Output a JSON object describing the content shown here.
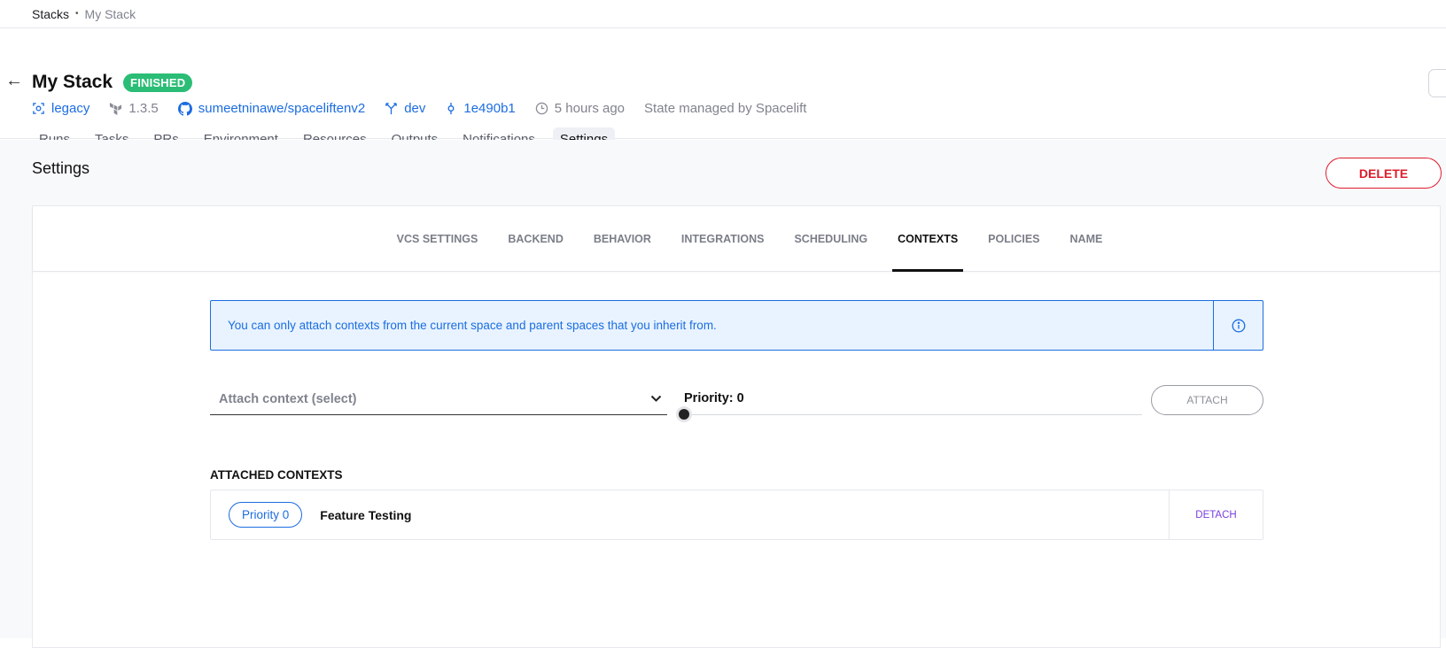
{
  "breadcrumb": {
    "root": "Stacks",
    "separator": "•",
    "current": "My Stack"
  },
  "stack": {
    "title": "My Stack",
    "status": "FINISHED",
    "status_color": "#2bbd76",
    "meta": {
      "space": "legacy",
      "version": "1.3.5",
      "repo": "sumeetninawe/spaceliftenv2",
      "branch": "dev",
      "commit": "1e490b1",
      "time": "5 hours ago",
      "state": "State managed by Spacelift"
    }
  },
  "tabs": [
    {
      "label": "Runs",
      "active": false
    },
    {
      "label": "Tasks",
      "active": false
    },
    {
      "label": "PRs",
      "active": false
    },
    {
      "label": "Environment",
      "active": false
    },
    {
      "label": "Resources",
      "active": false
    },
    {
      "label": "Outputs",
      "active": false
    },
    {
      "label": "Notifications",
      "active": false
    },
    {
      "label": "Settings",
      "active": true
    }
  ],
  "settings": {
    "title": "Settings",
    "delete_label": "DELETE",
    "subtabs": [
      {
        "label": "VCS SETTINGS",
        "active": false
      },
      {
        "label": "BACKEND",
        "active": false
      },
      {
        "label": "BEHAVIOR",
        "active": false
      },
      {
        "label": "INTEGRATIONS",
        "active": false
      },
      {
        "label": "SCHEDULING",
        "active": false
      },
      {
        "label": "CONTEXTS",
        "active": true
      },
      {
        "label": "POLICIES",
        "active": false
      },
      {
        "label": "NAME",
        "active": false
      }
    ],
    "info_text": "You can only attach contexts from the current space and parent spaces that you inherit from.",
    "select_placeholder": "Attach context (select)",
    "priority_label": "Priority: 0",
    "priority_value": 0,
    "attach_label": "ATTACH",
    "attached_heading": "ATTACHED CONTEXTS",
    "attached": [
      {
        "priority": "Priority 0",
        "name": "Feature Testing",
        "action": "DETACH"
      }
    ]
  },
  "colors": {
    "accent": "#1c6de0",
    "danger": "#dd1c2c",
    "detach": "#7a3ee0"
  }
}
